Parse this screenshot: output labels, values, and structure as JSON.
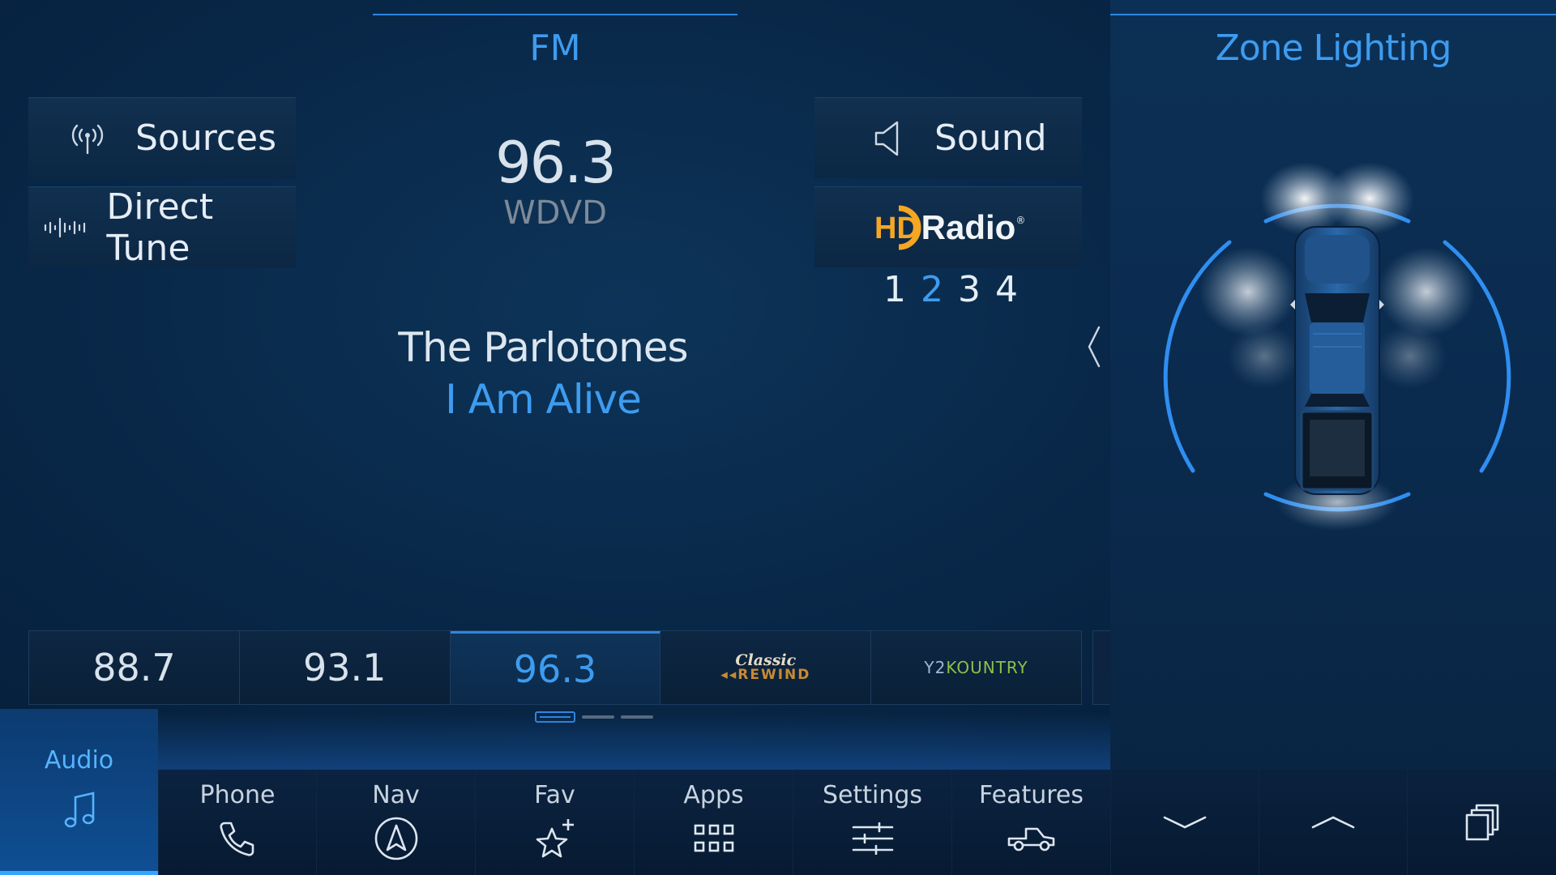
{
  "audio": {
    "band": "FM",
    "sources_label": "Sources",
    "direct_tune_label": "Direct Tune",
    "sound_label": "Sound",
    "hd_logo_hd": "HD",
    "hd_logo_text": "Radio",
    "hd_channels": [
      "1",
      "2",
      "3",
      "4"
    ],
    "hd_active_channel": "2",
    "frequency": "96.3",
    "callsign": "WDVD",
    "artist": "The Parlotones",
    "song": "I Am Alive",
    "presets": [
      {
        "label": "88.7",
        "active": false
      },
      {
        "label": "93.1",
        "active": false
      },
      {
        "label": "96.3",
        "active": true
      },
      {
        "logo_line1": "Classic",
        "logo_line2": "REWIND",
        "active": false
      },
      {
        "logo_prefix": "Y2",
        "logo_k": "K",
        "logo_rest": "OUNTRY",
        "active": false
      }
    ],
    "pages": 3,
    "current_page": 1
  },
  "zone": {
    "title": "Zone Lighting"
  },
  "nav": {
    "audio": "Audio",
    "phone": "Phone",
    "nav": "Nav",
    "fav": "Fav",
    "apps": "Apps",
    "settings": "Settings",
    "features": "Features"
  },
  "icons": [
    "antenna-icon",
    "waveform-icon",
    "speaker-icon",
    "music-note-icon",
    "phone-icon",
    "compass-icon",
    "star-plus-icon",
    "apps-grid-icon",
    "sliders-icon",
    "truck-icon",
    "chevron-down-icon",
    "chevron-up-icon",
    "windows-icon",
    "chevron-left-icon"
  ],
  "colors": {
    "accent": "#3d9cf0",
    "hd_orange": "#f5a623",
    "background": "#082646"
  }
}
